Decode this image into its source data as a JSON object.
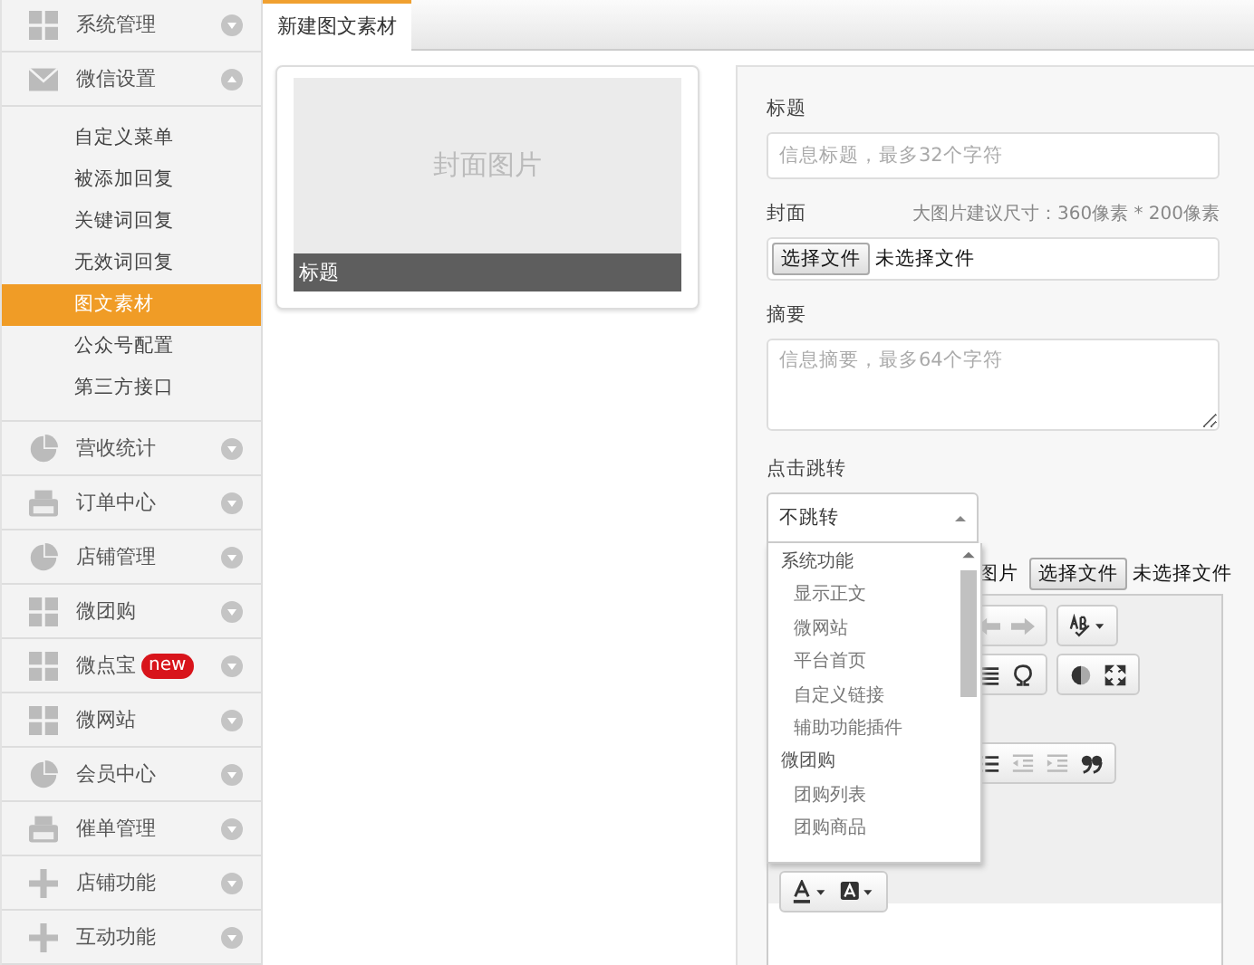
{
  "sidebar": {
    "items": [
      {
        "label": "系统管理",
        "kind": "grid",
        "expanded": false
      },
      {
        "label": "微信设置",
        "kind": "mail",
        "expanded": true,
        "children": [
          {
            "label": "自定义菜单",
            "selected": false
          },
          {
            "label": "被添加回复",
            "selected": false
          },
          {
            "label": "关键词回复",
            "selected": false
          },
          {
            "label": "无效词回复",
            "selected": false
          },
          {
            "label": "图文素材",
            "selected": true
          },
          {
            "label": "公众号配置",
            "selected": false
          },
          {
            "label": "第三方接口",
            "selected": false
          }
        ]
      },
      {
        "label": "营收统计",
        "kind": "pie",
        "expanded": false
      },
      {
        "label": "订单中心",
        "kind": "printer",
        "expanded": false
      },
      {
        "label": "店铺管理",
        "kind": "pie",
        "expanded": false
      },
      {
        "label": "微团购",
        "kind": "grid",
        "expanded": false
      },
      {
        "label": "微点宝",
        "kind": "grid",
        "expanded": false,
        "badge": "new"
      },
      {
        "label": "微网站",
        "kind": "grid",
        "expanded": false
      },
      {
        "label": "会员中心",
        "kind": "pie",
        "expanded": false
      },
      {
        "label": "催单管理",
        "kind": "printer",
        "expanded": false
      },
      {
        "label": "店铺功能",
        "kind": "plus",
        "expanded": false
      },
      {
        "label": "互动功能",
        "kind": "plus",
        "expanded": false
      }
    ]
  },
  "tabs": [
    {
      "label": "新建图文素材",
      "selected": true
    }
  ],
  "preview": {
    "cover_text": "封面图片",
    "title": "标题"
  },
  "form": {
    "title": {
      "label": "标题",
      "placeholder": "信息标题，最多32个字符"
    },
    "cover": {
      "label": "封面",
      "hint": "大图片建议尺寸：360像素 * 200像素",
      "button": "选择文件",
      "status": "未选择文件"
    },
    "summary": {
      "label": "摘要",
      "placeholder": "信息摘要，最多64个字符"
    },
    "link": {
      "label": "点击跳转",
      "value": "不跳转",
      "expanded": true,
      "options": [
        {
          "label": "系统功能",
          "kind": "group"
        },
        {
          "label": "显示正文",
          "kind": "option"
        },
        {
          "label": "微网站",
          "kind": "option"
        },
        {
          "label": "平台首页",
          "kind": "option"
        },
        {
          "label": "自定义链接",
          "kind": "option"
        },
        {
          "label": "辅助功能插件",
          "kind": "option"
        },
        {
          "label": "微团购",
          "kind": "group"
        },
        {
          "label": "团购列表",
          "kind": "option"
        },
        {
          "label": "团购商品",
          "kind": "option"
        }
      ]
    },
    "body_image": {
      "label": "图片",
      "button": "选择文件",
      "status": "未选择文件"
    }
  }
}
